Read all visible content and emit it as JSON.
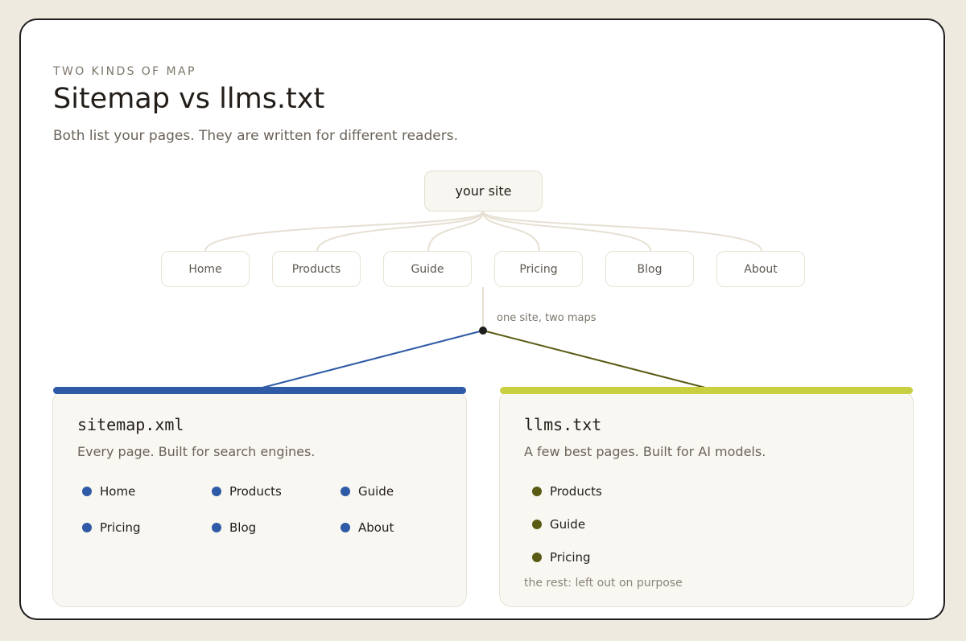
{
  "header": {
    "eyebrow": "TWO KINDS OF MAP",
    "title": "Sitemap vs llms.txt",
    "subtitle": "Both list your pages. They are written for different readers."
  },
  "tree": {
    "root": "your site",
    "pages": [
      "Home",
      "Products",
      "Guide",
      "Pricing",
      "Blog",
      "About"
    ],
    "join_note": "one site, two maps"
  },
  "cards": {
    "sitemap": {
      "title": "sitemap.xml",
      "description": "Every page. Built for search engines.",
      "items": [
        "Home",
        "Products",
        "Guide",
        "Pricing",
        "Blog",
        "About"
      ]
    },
    "llms": {
      "title": "llms.txt",
      "description": "A few best pages. Built for AI models.",
      "items": [
        "Products",
        "Guide",
        "Pricing"
      ],
      "note": "the rest: left out on purpose"
    }
  },
  "colors": {
    "sitemap_accent": "#2e5aa6",
    "llms_accent": "#c8d042",
    "llms_dot": "#5a5a14",
    "connector": "#e6e0d2",
    "frame_border": "#1e1e1e",
    "page_background": "#efeae0"
  }
}
